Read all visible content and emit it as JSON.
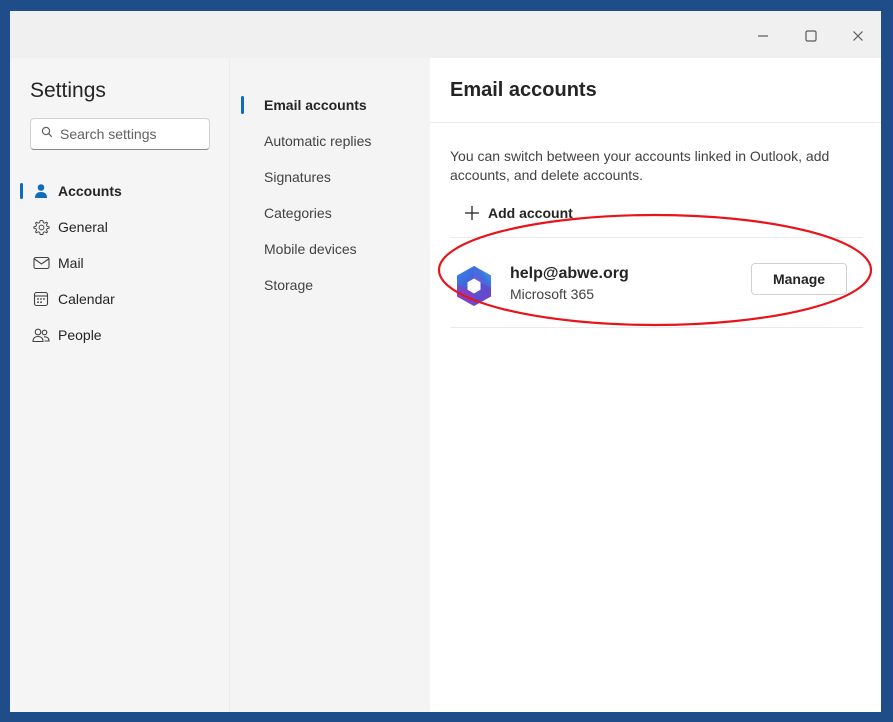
{
  "colors": {
    "frame": "#1f4d8a",
    "accent": "#0f6cbd",
    "annotation": "#e8141c"
  },
  "window_controls": {
    "minimize_icon": "minimize-icon",
    "maximize_icon": "maximize-icon",
    "close_icon": "close-icon"
  },
  "sidebar": {
    "title": "Settings",
    "search_placeholder": "Search settings",
    "items": [
      {
        "label": "Accounts",
        "icon": "person-icon",
        "active": true
      },
      {
        "label": "General",
        "icon": "gear-icon",
        "active": false
      },
      {
        "label": "Mail",
        "icon": "mail-icon",
        "active": false
      },
      {
        "label": "Calendar",
        "icon": "calendar-icon",
        "active": false
      },
      {
        "label": "People",
        "icon": "people-icon",
        "active": false
      }
    ]
  },
  "subnav": {
    "items": [
      {
        "label": "Email accounts",
        "active": true
      },
      {
        "label": "Automatic replies",
        "active": false
      },
      {
        "label": "Signatures",
        "active": false
      },
      {
        "label": "Categories",
        "active": false
      },
      {
        "label": "Mobile devices",
        "active": false
      },
      {
        "label": "Storage",
        "active": false
      }
    ]
  },
  "content": {
    "title": "Email accounts",
    "description": "You can switch between your accounts linked in Outlook, add accounts, and delete accounts.",
    "add_account_label": "Add account",
    "accounts": [
      {
        "email": "help@abwe.org",
        "type": "Microsoft 365",
        "logo": "microsoft-365-logo",
        "button_label": "Manage"
      }
    ]
  }
}
